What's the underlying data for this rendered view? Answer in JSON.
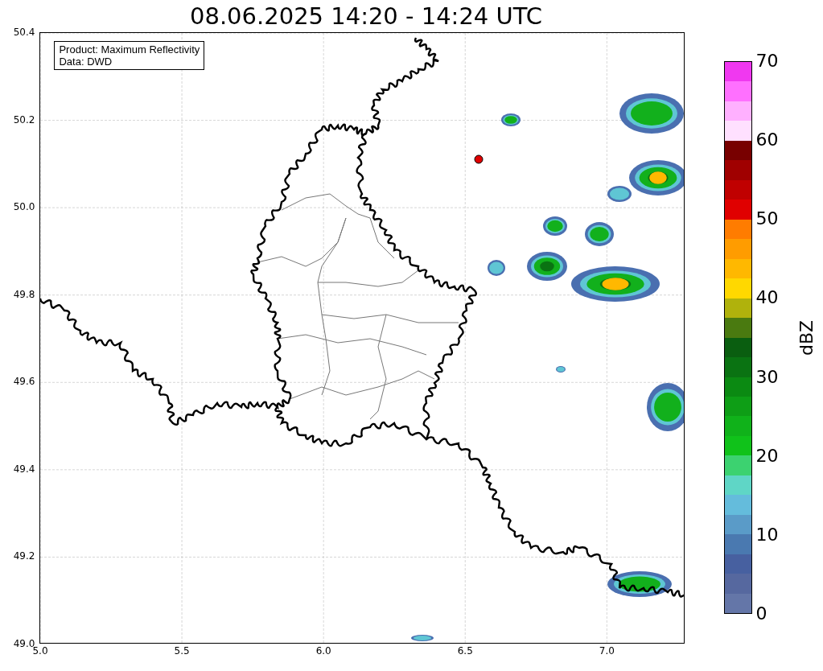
{
  "title": "08.06.2025 14:20 - 14:24 UTC",
  "legend": [
    "Product: Maximum Reflectivity",
    "Data: DWD"
  ],
  "x_axis": {
    "ticks": [
      "5.0",
      "5.5",
      "6.0",
      "6.5",
      "7.0"
    ]
  },
  "y_axis": {
    "ticks": [
      "50.4",
      "50.2",
      "50.0",
      "49.8",
      "49.6",
      "49.4",
      "49.2",
      "49.0"
    ]
  },
  "colorbar": {
    "label": "dBZ",
    "ticks": [
      "70",
      "60",
      "50",
      "40",
      "30",
      "20",
      "10",
      "0"
    ],
    "segments": [
      {
        "color": "#f038f0"
      },
      {
        "color": "#ff70ff"
      },
      {
        "color": "#ffb0ff"
      },
      {
        "color": "#ffe0ff"
      },
      {
        "color": "#780000"
      },
      {
        "color": "#a00000"
      },
      {
        "color": "#c00000"
      },
      {
        "color": "#e00000"
      },
      {
        "color": "#ff7c00"
      },
      {
        "color": "#ff9c00"
      },
      {
        "color": "#ffb800"
      },
      {
        "color": "#ffd800"
      },
      {
        "color": "#b0b20c"
      },
      {
        "color": "#4a7a10"
      },
      {
        "color": "#0a5e10"
      },
      {
        "color": "#0a7312"
      },
      {
        "color": "#0b8a12"
      },
      {
        "color": "#0e9e16"
      },
      {
        "color": "#10b21a"
      },
      {
        "color": "#10c21a"
      },
      {
        "color": "#3cd270"
      },
      {
        "color": "#5fd6c6"
      },
      {
        "color": "#64bcdc"
      },
      {
        "color": "#5a9bc8"
      },
      {
        "color": "#4a79b0"
      },
      {
        "color": "#4760a0"
      },
      {
        "color": "#56689f"
      },
      {
        "color": "#6476a8"
      }
    ]
  }
}
